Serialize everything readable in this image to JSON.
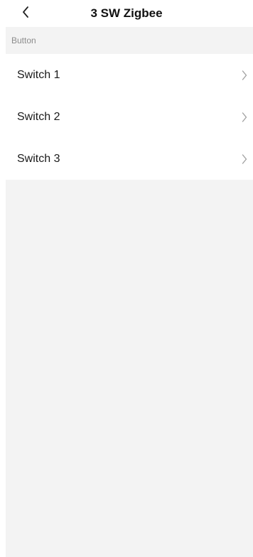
{
  "header": {
    "title": "3 SW Zigbee",
    "back_icon": "chevron-left-icon"
  },
  "section": {
    "label": "Button"
  },
  "items": [
    {
      "label": "Switch 1",
      "icon": "chevron-right-icon"
    },
    {
      "label": "Switch 2",
      "icon": "chevron-right-icon"
    },
    {
      "label": "Switch 3",
      "icon": "chevron-right-icon"
    }
  ],
  "colors": {
    "background": "#ffffff",
    "content_background": "#f3f3f3",
    "section_text": "#8c8c8c",
    "chevron": "#9e9e9e"
  }
}
